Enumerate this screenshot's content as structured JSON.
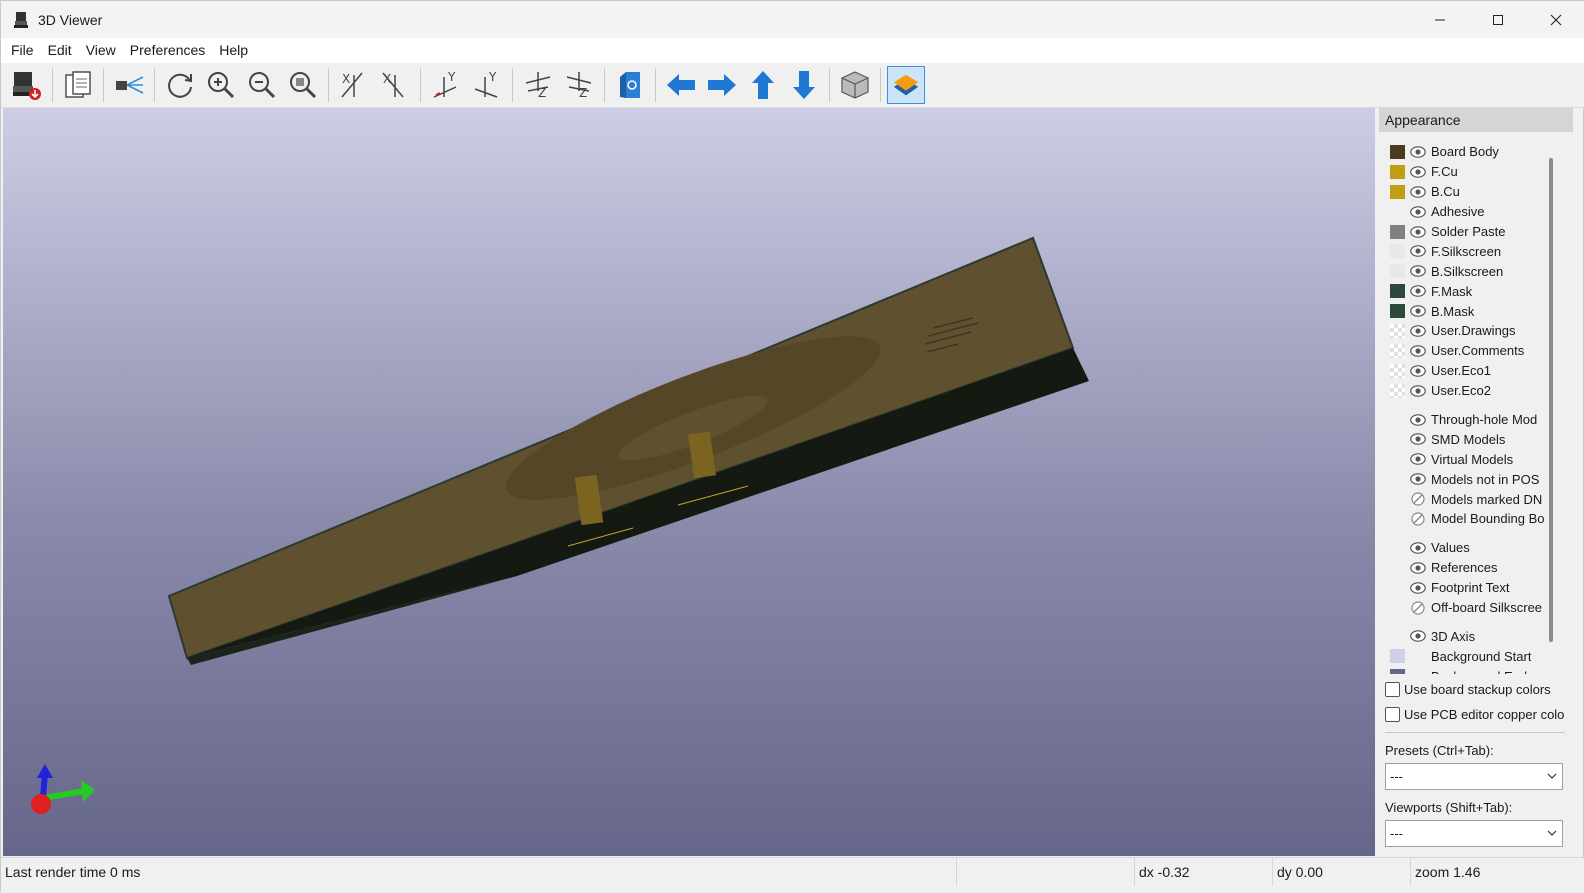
{
  "window": {
    "title": "3D Viewer",
    "icon": "kicad-3d-viewer-icon",
    "controls": [
      "minimize-icon",
      "maximize-icon",
      "close-icon"
    ]
  },
  "menu": {
    "file": "File",
    "edit": "Edit",
    "view": "View",
    "preferences": "Preferences",
    "help": "Help"
  },
  "toolbar": {
    "buttons": [
      "export-image-icon",
      "copy-to-clipboard-icon",
      "raytrace-icon",
      "reload-board-icon",
      "zoom-in-icon",
      "zoom-out-icon",
      "zoom-fit-icon",
      "rotate-x-cw-icon",
      "rotate-x-ccw-icon",
      "rotate-y-cw-icon",
      "rotate-y-ccw-icon",
      "rotate-z-cw-icon",
      "rotate-z-ccw-icon",
      "flip-view-icon",
      "move-left-icon",
      "move-right-icon",
      "move-up-icon",
      "move-down-icon",
      "ortho-toggle-icon",
      "layers-manager-icon"
    ],
    "active": "layers-manager-icon"
  },
  "appearance": {
    "header": "Appearance",
    "layers": [
      {
        "label": "Board Body",
        "color": "#4a3b22",
        "swatch": "solid",
        "visible": true
      },
      {
        "label": "F.Cu",
        "color": "#bf9e14",
        "swatch": "solid",
        "visible": true
      },
      {
        "label": "B.Cu",
        "color": "#bf9e14",
        "swatch": "solid",
        "visible": true
      },
      {
        "label": "Adhesive",
        "color": "",
        "swatch": "none",
        "visible": true
      },
      {
        "label": "Solder Paste",
        "color": "#808080",
        "swatch": "solid",
        "visible": true
      },
      {
        "label": "F.Silkscreen",
        "color": "#e8e8e8",
        "swatch": "solid",
        "visible": true
      },
      {
        "label": "B.Silkscreen",
        "color": "#e8e8e8",
        "swatch": "solid",
        "visible": true
      },
      {
        "label": "F.Mask",
        "color": "#2f4a3c",
        "swatch": "solid",
        "visible": true
      },
      {
        "label": "B.Mask",
        "color": "#2f4a3c",
        "swatch": "solid",
        "visible": true
      },
      {
        "label": "User.Drawings",
        "color": "",
        "swatch": "checker",
        "visible": true
      },
      {
        "label": "User.Comments",
        "color": "",
        "swatch": "checker",
        "visible": true
      },
      {
        "label": "User.Eco1",
        "color": "",
        "swatch": "checker",
        "visible": true
      },
      {
        "label": "User.Eco2",
        "color": "",
        "swatch": "checker",
        "visible": true
      },
      {
        "label": "Through-hole Mod",
        "color": "",
        "swatch": "none",
        "visible": true,
        "gap": true
      },
      {
        "label": "SMD Models",
        "color": "",
        "swatch": "none",
        "visible": true
      },
      {
        "label": "Virtual Models",
        "color": "",
        "swatch": "none",
        "visible": true
      },
      {
        "label": "Models not in POS",
        "color": "",
        "swatch": "none",
        "visible": true
      },
      {
        "label": "Models marked DN",
        "color": "",
        "swatch": "none",
        "visible": false
      },
      {
        "label": "Model Bounding Bo",
        "color": "",
        "swatch": "none",
        "visible": false
      },
      {
        "label": "Values",
        "color": "",
        "swatch": "none",
        "visible": true,
        "gap": true
      },
      {
        "label": "References",
        "color": "",
        "swatch": "none",
        "visible": true
      },
      {
        "label": "Footprint Text",
        "color": "",
        "swatch": "none",
        "visible": true
      },
      {
        "label": "Off-board Silkscree",
        "color": "",
        "swatch": "none",
        "visible": false
      },
      {
        "label": "3D Axis",
        "color": "",
        "swatch": "none",
        "visible": true,
        "gap": true
      },
      {
        "label": "Background Start",
        "color": "#cfcfe8",
        "swatch": "solid",
        "visible": null
      },
      {
        "label": "Background End",
        "color": "#66668a",
        "swatch": "solid",
        "visible": null
      }
    ],
    "use_board_stackup_colors": "Use board stackup colors",
    "use_pcb_editor_copper": "Use PCB editor copper colo",
    "presets_label": "Presets (Ctrl+Tab):",
    "presets_value": "---",
    "viewports_label": "Viewports (Shift+Tab):",
    "viewports_value": "---"
  },
  "status": {
    "render_time": "Last render time 0 ms",
    "dx": "dx -0.32",
    "dy": "dy 0.00",
    "zoom": "zoom 1.46"
  }
}
